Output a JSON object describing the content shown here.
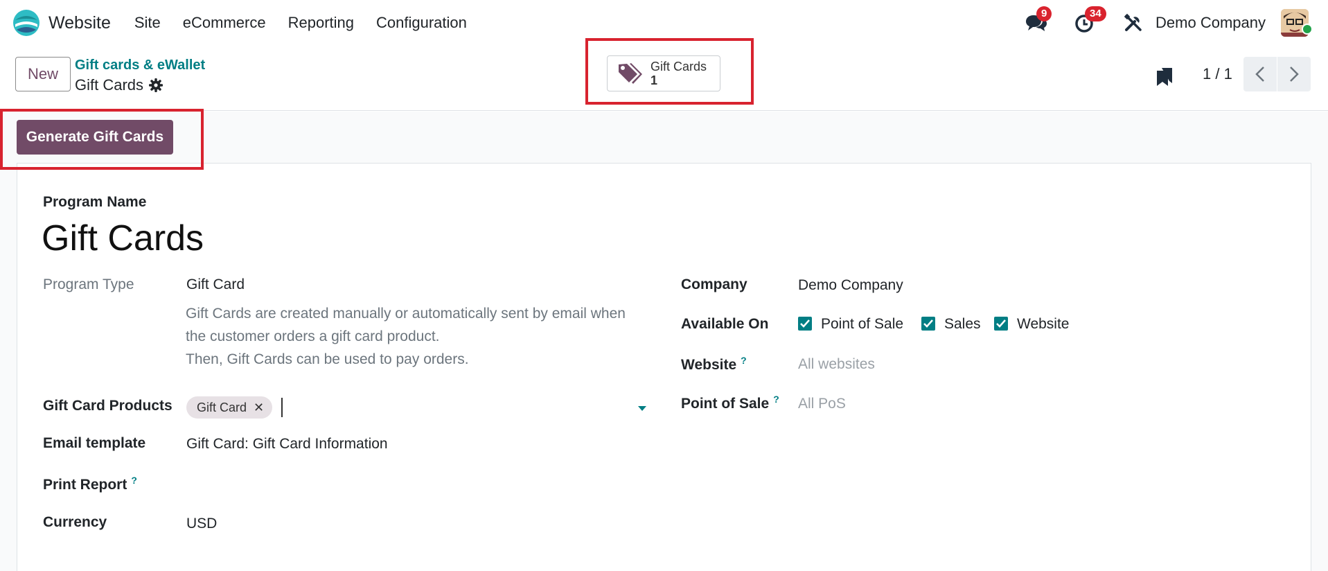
{
  "app": {
    "name": "Website",
    "menu": [
      "Site",
      "eCommerce",
      "Reporting",
      "Configuration"
    ],
    "messages_count": "9",
    "activities_count": "34",
    "company": "Demo Company"
  },
  "control_panel": {
    "new_label": "New",
    "breadcrumb_parent": "Gift cards & eWallet",
    "breadcrumb_current": "Gift Cards",
    "smart_button": {
      "label": "Gift Cards",
      "count": "1"
    },
    "pager": "1 / 1"
  },
  "actions": {
    "generate_label": "Generate Gift Cards"
  },
  "form": {
    "program_name_label": "Program Name",
    "program_name": "Gift Cards",
    "program_type_label": "Program Type",
    "program_type": "Gift Card",
    "description": [
      "Gift Cards are created manually or automatically sent by email when",
      "the customer orders a gift card product.",
      "Then, Gift Cards can be used to pay orders."
    ],
    "products_label": "Gift Card Products",
    "product_tag": "Gift Card",
    "email_template_label": "Email template",
    "email_template": "Gift Card: Gift Card Information",
    "print_report_label": "Print Report",
    "currency_label": "Currency",
    "currency": "USD",
    "company_label": "Company",
    "company": "Demo Company",
    "available_on_label": "Available On",
    "available_on": [
      "Point of Sale",
      "Sales",
      "Website"
    ],
    "website_label": "Website",
    "website_placeholder": "All websites",
    "pos_label": "Point of Sale",
    "pos_placeholder": "All PoS",
    "help_mark": "?"
  },
  "colors": {
    "primary": "#714b67",
    "accent": "#017e84",
    "highlight": "#d8232f",
    "badge": "#d9232e"
  }
}
